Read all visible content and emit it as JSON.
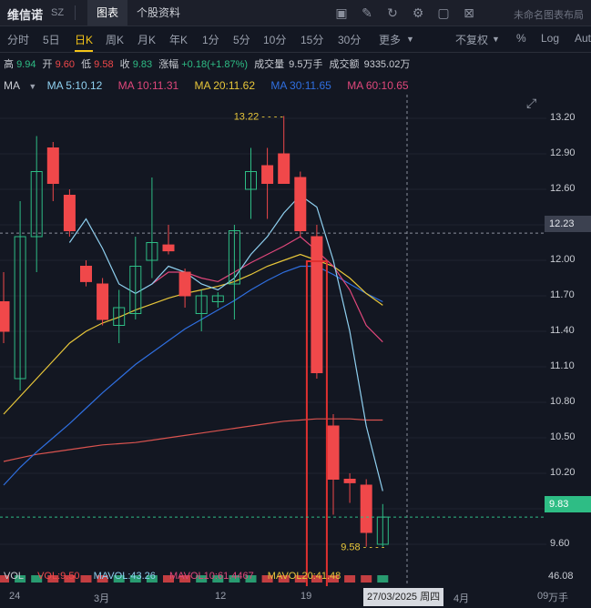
{
  "topbar": {
    "name": "维信诺",
    "exchange": "SZ",
    "tabs": [
      "图表",
      "个股资料"
    ],
    "icons": [
      "image-icon",
      "pen-icon",
      "refresh-icon",
      "settings-icon",
      "window-icon",
      "close-icon"
    ],
    "layout_label": "未命名图表布局"
  },
  "periods": {
    "items": [
      "分时",
      "5日",
      "日K",
      "周K",
      "月K",
      "年K",
      "1分",
      "5分",
      "10分",
      "15分",
      "30分",
      "更多"
    ],
    "active": "日K",
    "adjust": "不复权",
    "percent": "%",
    "log": "Log",
    "auto": "Auto"
  },
  "info": {
    "high_label": "高",
    "high": "9.94",
    "open_label": "开",
    "open": "9.60",
    "low_label": "低",
    "low": "9.58",
    "close_label": "收",
    "close": "9.83",
    "change_label": "涨幅",
    "change": "+0.18(+1.87%)",
    "vol_label": "成交量",
    "vol": "9.5万手",
    "amount_label": "成交额",
    "amount": "9335.02万"
  },
  "ma": {
    "title": "MA",
    "ma5": "MA 5:10.12",
    "ma10": "MA 10:11.31",
    "ma20": "MA 20:11.62",
    "ma30": "MA 30:11.65",
    "ma60": "MA 60:10.65"
  },
  "colors": {
    "up": "#2ebd85",
    "down": "#f0484a",
    "ma5": "#8fd0f0",
    "ma10": "#e0477b",
    "ma20": "#e8c73a",
    "ma30": "#2f6fe0",
    "ma60": "#d9534f",
    "highlight": "#e03030"
  },
  "y_axis": [
    "13.20",
    "12.90",
    "12.60",
    "12.30",
    "12.00",
    "11.70",
    "11.40",
    "11.10",
    "10.80",
    "10.50",
    "10.20",
    "9.90",
    "9.60"
  ],
  "crosshair_price": "12.23",
  "last_price": "9.83",
  "high_marker": "13.22",
  "low_marker": "9.58",
  "x_axis": [
    "24",
    "3月",
    "12",
    "19",
    "4月",
    "09"
  ],
  "date_tip": "27/03/2025 周四",
  "volume": {
    "vol": "VOL",
    "vol_value": "VOL:9.50",
    "mavol": "MAVOL",
    "mavol_value": "MAVOL:43.26",
    "ma_vol10": "MAVOL10:61.4467",
    "ma_vol20": "MAVOL20:41.48",
    "axis": "46.08",
    "unit": "万手"
  },
  "chart_data": {
    "type": "candlestick",
    "y_range": [
      9.4,
      13.4
    ],
    "candles": [
      {
        "o": 11.65,
        "h": 11.9,
        "l": 11.3,
        "c": 11.4
      },
      {
        "o": 11.0,
        "h": 12.5,
        "l": 10.9,
        "c": 12.2
      },
      {
        "o": 12.2,
        "h": 13.05,
        "l": 11.9,
        "c": 12.75
      },
      {
        "o": 12.95,
        "h": 13.0,
        "l": 12.5,
        "c": 12.65
      },
      {
        "o": 12.55,
        "h": 12.6,
        "l": 12.2,
        "c": 12.25
      },
      {
        "o": 11.95,
        "h": 12.0,
        "l": 11.78,
        "c": 11.82
      },
      {
        "o": 11.8,
        "h": 11.85,
        "l": 11.45,
        "c": 11.5
      },
      {
        "o": 11.45,
        "h": 11.75,
        "l": 11.3,
        "c": 11.6
      },
      {
        "o": 11.55,
        "h": 12.2,
        "l": 11.5,
        "c": 11.95
      },
      {
        "o": 12.0,
        "h": 12.7,
        "l": 11.85,
        "c": 12.15
      },
      {
        "o": 12.13,
        "h": 12.3,
        "l": 12.05,
        "c": 12.08
      },
      {
        "o": 11.9,
        "h": 11.93,
        "l": 11.6,
        "c": 11.7
      },
      {
        "o": 11.55,
        "h": 11.75,
        "l": 11.4,
        "c": 11.7
      },
      {
        "o": 11.65,
        "h": 11.73,
        "l": 11.6,
        "c": 11.7
      },
      {
        "o": 11.8,
        "h": 12.3,
        "l": 11.5,
        "c": 12.25
      },
      {
        "o": 12.6,
        "h": 12.95,
        "l": 12.35,
        "c": 12.75
      },
      {
        "o": 12.8,
        "h": 12.95,
        "l": 12.35,
        "c": 12.65
      },
      {
        "o": 12.9,
        "h": 13.22,
        "l": 12.7,
        "c": 12.65
      },
      {
        "o": 12.7,
        "h": 12.75,
        "l": 12.2,
        "c": 12.25
      },
      {
        "o": 12.2,
        "h": 12.3,
        "l": 11.0,
        "c": 11.05
      },
      {
        "o": 10.6,
        "h": 10.7,
        "l": 9.85,
        "c": 10.15
      },
      {
        "o": 10.15,
        "h": 10.2,
        "l": 9.95,
        "c": 10.12
      },
      {
        "o": 10.1,
        "h": 10.15,
        "l": 9.58,
        "c": 9.7
      },
      {
        "o": 9.6,
        "h": 9.94,
        "l": 9.58,
        "c": 9.83
      }
    ],
    "ma5": [
      null,
      null,
      null,
      null,
      12.15,
      12.35,
      12.1,
      11.8,
      11.72,
      11.8,
      11.95,
      11.9,
      11.8,
      11.75,
      11.85,
      12.05,
      12.2,
      12.4,
      12.55,
      12.45,
      12.0,
      11.4,
      10.6,
      10.05
    ],
    "ma10": [
      null,
      null,
      null,
      null,
      null,
      null,
      null,
      null,
      null,
      11.8,
      11.9,
      11.9,
      11.85,
      11.82,
      11.9,
      11.98,
      12.05,
      12.12,
      12.2,
      12.08,
      11.95,
      11.75,
      11.45,
      11.31
    ],
    "ma20": [
      10.7,
      10.85,
      11.0,
      11.15,
      11.3,
      11.4,
      11.47,
      11.52,
      11.58,
      11.63,
      11.68,
      11.72,
      11.75,
      11.78,
      11.82,
      11.88,
      11.95,
      12.0,
      12.05,
      12.0,
      11.95,
      11.85,
      11.72,
      11.62
    ],
    "ma30": [
      10.1,
      10.25,
      10.38,
      10.5,
      10.62,
      10.75,
      10.88,
      11.0,
      11.12,
      11.22,
      11.32,
      11.42,
      11.5,
      11.58,
      11.66,
      11.75,
      11.83,
      11.9,
      11.95,
      11.95,
      11.88,
      11.8,
      11.72,
      11.65
    ],
    "ma60": [
      10.3,
      10.33,
      10.36,
      10.38,
      10.4,
      10.42,
      10.44,
      10.45,
      10.46,
      10.48,
      10.5,
      10.52,
      10.54,
      10.56,
      10.58,
      10.6,
      10.62,
      10.64,
      10.65,
      10.66,
      10.66,
      10.66,
      10.65,
      10.65
    ]
  }
}
